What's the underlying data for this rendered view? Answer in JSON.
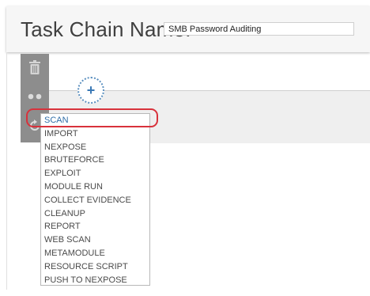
{
  "header": {
    "title": "Task Chain Name:",
    "name_value": "SMB Password Auditing"
  },
  "toolbar": {
    "icons": [
      "trash-icon",
      "dots-icon",
      "refresh-icon"
    ]
  },
  "add_button": {
    "label": "+"
  },
  "menu": {
    "selected": "SCAN",
    "items": [
      "SCAN",
      "IMPORT",
      "NEXPOSE",
      "BRUTEFORCE",
      "EXPLOIT",
      "MODULE RUN",
      "COLLECT EVIDENCE",
      "CLEANUP",
      "REPORT",
      "WEB SCAN",
      "METAMODULE",
      "RESOURCE SCRIPT",
      "PUSH TO NEXPOSE"
    ]
  },
  "colors": {
    "accent_blue": "#2f6ea8",
    "highlight_red": "#d8323c",
    "toolbar_gray": "#8d8d8d"
  }
}
